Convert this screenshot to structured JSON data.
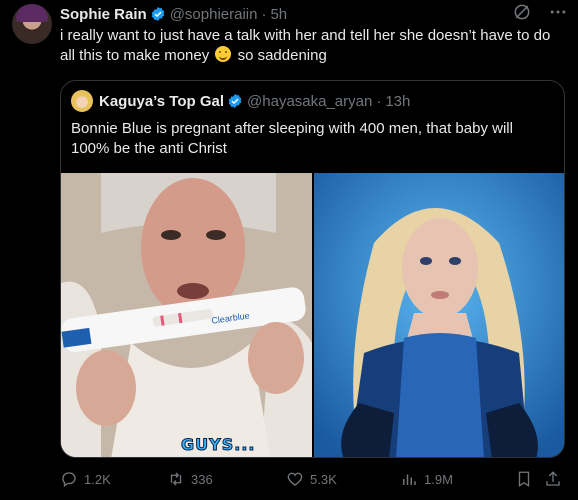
{
  "post": {
    "author_name": "Sophie Rain",
    "handle": "@sophieraiin",
    "separator": "·",
    "time": "5h",
    "text_before_emoji": "i really want to just have a talk with her and tell her she doesn’t have to do all this to make money",
    "text_after_emoji": "so saddening",
    "emoji_icon": "slightly-smiling-face-emoji"
  },
  "quote": {
    "author_name": "Kaguya’s Top Gal",
    "handle": "@hayasaka_aryan",
    "separator": "·",
    "time": "13h",
    "text": "Bonnie Blue is pregnant after sleeping with 400 men, that baby will 100% be the anti Christ",
    "image_left_caption": "GUYS...",
    "test_brand": "Clearblue"
  },
  "actions": {
    "replies": "1.2K",
    "reposts": "336",
    "likes": "5.3K",
    "views": "1.9M"
  },
  "colors": {
    "background": "#000000",
    "text": "#e7e9ea",
    "muted": "#71767b",
    "verified": "#1d9bf0",
    "border": "#2f3336"
  }
}
